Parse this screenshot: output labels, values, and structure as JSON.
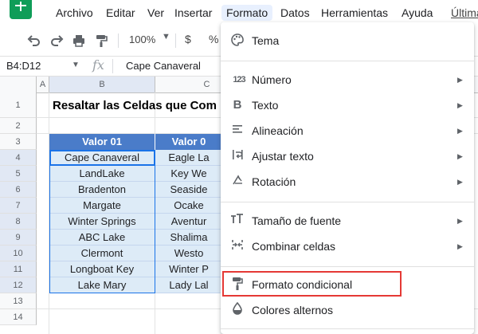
{
  "menubar": {
    "items": [
      "Archivo",
      "Editar",
      "Ver",
      "Insertar",
      "Formato",
      "Datos",
      "Herramientas",
      "Ayuda",
      "Última"
    ]
  },
  "toolbar": {
    "zoom": "100%",
    "currency": "$",
    "percent": "%"
  },
  "formula_bar": {
    "name_box": "B4:D12",
    "fx": "fx",
    "value": "Cape Canaveral"
  },
  "grid": {
    "columns": [
      "A",
      "B",
      "C"
    ],
    "rows": [
      "1",
      "2",
      "3",
      "4",
      "5",
      "6",
      "7",
      "8",
      "9",
      "10",
      "11",
      "12",
      "13",
      "14"
    ],
    "title": "Resaltar las Celdas que Com",
    "headers": [
      "Valor 01",
      "Valor 0"
    ],
    "col_b": [
      "Cape Canaveral",
      "LandLake",
      "Bradenton",
      "Margate",
      "Winter Springs",
      "ABC Lake",
      "Clermont",
      "Longboat Key",
      "Lake Mary"
    ],
    "col_c": [
      "Eagle La",
      "Key We",
      "Seaside",
      "Ocake",
      "Aventur",
      "Shalima",
      "Westo",
      "Winter P",
      "Lady Lal"
    ]
  },
  "format_menu": {
    "items": [
      {
        "label": "Tema",
        "icon": "palette-icon",
        "arrow": false
      },
      {
        "label": "Número",
        "icon": "number-icon",
        "arrow": true
      },
      {
        "label": "Texto",
        "icon": "bold-icon",
        "arrow": true
      },
      {
        "label": "Alineación",
        "icon": "align-icon",
        "arrow": true
      },
      {
        "label": "Ajustar texto",
        "icon": "wrap-icon",
        "arrow": true
      },
      {
        "label": "Rotación",
        "icon": "rotate-icon",
        "arrow": true
      },
      {
        "label": "Tamaño de fuente",
        "icon": "font-size-icon",
        "arrow": true
      },
      {
        "label": "Combinar celdas",
        "icon": "merge-icon",
        "arrow": true
      },
      {
        "label": "Formato condicional",
        "icon": "paint-roller-icon",
        "arrow": false
      },
      {
        "label": "Colores alternos",
        "icon": "alternating-colors-icon",
        "arrow": false
      }
    ],
    "icon_glyphs": {
      "number": "123",
      "bold": "B"
    }
  },
  "colors": {
    "header_bg": "#4a7cc9",
    "cell_bg": "#ddebf7",
    "highlight": "#e53935",
    "selection": "#1a73e8"
  }
}
